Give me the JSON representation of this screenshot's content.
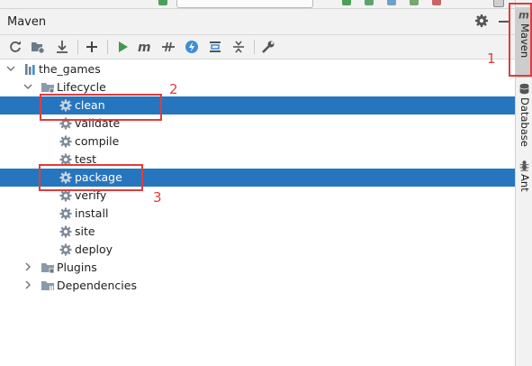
{
  "panel": {
    "title": "Maven"
  },
  "toolbar": {
    "buttons": [
      "refresh-icon",
      "generate-sources-icon",
      "download-icon",
      "add-icon",
      "run-icon",
      "maven-goal-icon",
      "toggle-offline-icon",
      "skip-tests-icon",
      "show-dependencies-icon",
      "collapse-all-icon",
      "settings-wrench-icon"
    ]
  },
  "tree": {
    "project": "the_games",
    "lifecycle": {
      "label": "Lifecycle",
      "phases": [
        "clean",
        "validate",
        "compile",
        "test",
        "package",
        "verify",
        "install",
        "site",
        "deploy"
      ],
      "selected": [
        "clean",
        "package"
      ]
    },
    "plugins": "Plugins",
    "dependencies": "Dependencies"
  },
  "sidebar": {
    "tabs": [
      {
        "label": "Maven",
        "icon": "maven-icon",
        "active": true
      },
      {
        "label": "Database",
        "icon": "database-icon",
        "active": false
      },
      {
        "label": "Ant",
        "icon": "ant-icon",
        "active": false
      }
    ]
  },
  "annotations": {
    "n1": "1",
    "n2": "2",
    "n3": "3"
  },
  "colors": {
    "selection": "#2675bf",
    "annotation": "#e03c3c",
    "run_green": "#3f9b4c"
  }
}
